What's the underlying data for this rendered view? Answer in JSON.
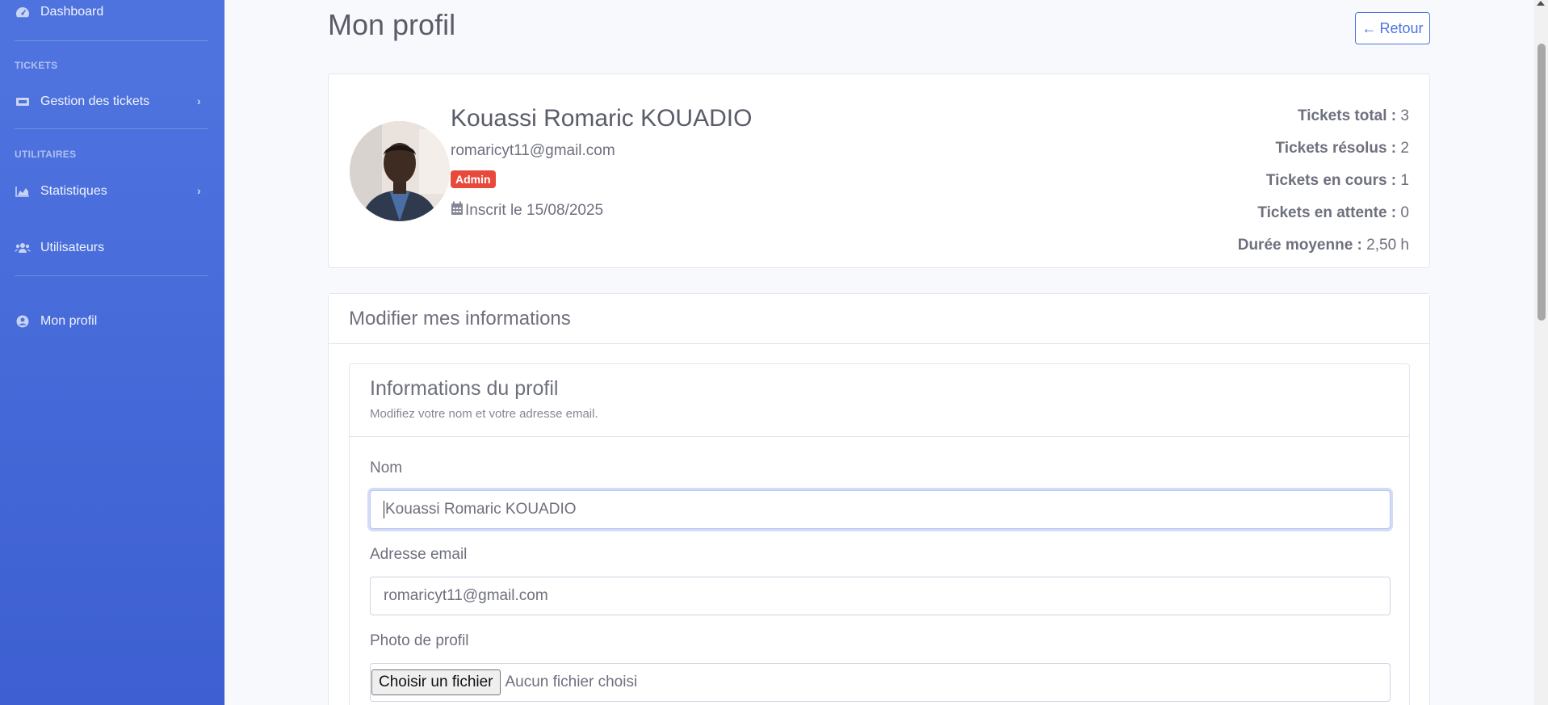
{
  "sidebar": {
    "dashboard": "Dashboard",
    "heading_tickets": "TICKETS",
    "gestion_tickets": "Gestion des tickets",
    "heading_utilitaires": "UTILITAIRES",
    "statistiques": "Statistiques",
    "utilisateurs": "Utilisateurs",
    "mon_profil": "Mon profil"
  },
  "page": {
    "title": "Mon profil",
    "back_label": "Retour"
  },
  "profile": {
    "name": "Kouassi Romaric KOUADIO",
    "email": "romaricyt11@gmail.com",
    "role": "Admin",
    "since": "Inscrit le 15/08/2025"
  },
  "stats": [
    {
      "label": "Tickets total :",
      "value": "3"
    },
    {
      "label": "Tickets résolus :",
      "value": "2"
    },
    {
      "label": "Tickets en cours :",
      "value": "1"
    },
    {
      "label": "Tickets en attente :",
      "value": "0"
    },
    {
      "label": "Durée moyenne :",
      "value": "2,50 h"
    }
  ],
  "edit": {
    "header": "Modifier mes informations",
    "section_title": "Informations du profil",
    "section_subtitle": "Modifiez votre nom et votre adresse email.",
    "name_label": "Nom",
    "name_value": "Kouassi Romaric KOUADIO",
    "email_label": "Adresse email",
    "email_value": "romaricyt11@gmail.com",
    "photo_label": "Photo de profil",
    "file_button": "Choisir un fichier",
    "file_status": "Aucun fichier choisi"
  },
  "colors": {
    "sidebar": "#4e73df",
    "badge": "#e74a3b",
    "primary": "#4e73df"
  }
}
